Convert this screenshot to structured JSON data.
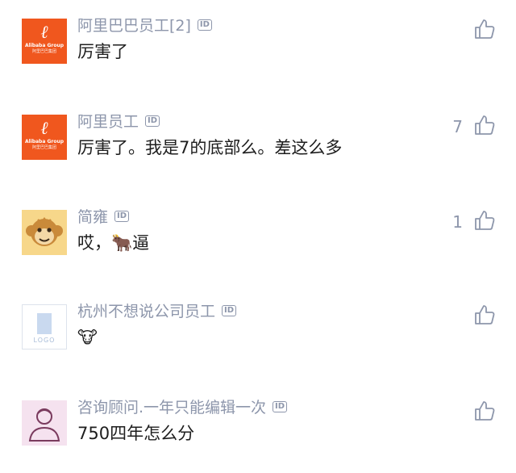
{
  "comments": [
    {
      "username": "阿里巴巴员工[2]",
      "badge": "ID",
      "text": "厉害了",
      "likes": "",
      "avatar": "alibaba-logo-avatar"
    },
    {
      "username": "阿里员工",
      "badge": "ID",
      "text": "厉害了。我是7的底部么。差这么多",
      "likes": "7",
      "avatar": "alibaba-logo-avatar"
    },
    {
      "username": "简雍",
      "badge": "ID",
      "text": "哎，🐂逼",
      "likes": "1",
      "avatar": "monkey-avatar"
    },
    {
      "username": "杭州不想说公司员工",
      "badge": "ID",
      "text": "🐮",
      "likes": "",
      "avatar": "logo-placeholder-avatar"
    },
    {
      "username": "咨询顾问.一年只能编辑一次",
      "badge": "ID",
      "text": "750四年怎么分",
      "likes": "",
      "avatar": "person-avatar"
    }
  ],
  "alibaba_avatar": {
    "brand": "Alibaba Group",
    "subbrand": "阿里巴巴集团"
  },
  "logo_avatar": {
    "text": "LOGO"
  },
  "colors": {
    "meta": "#8d96ab",
    "text": "#1e1e1e",
    "alibaba": "#f0571e"
  }
}
